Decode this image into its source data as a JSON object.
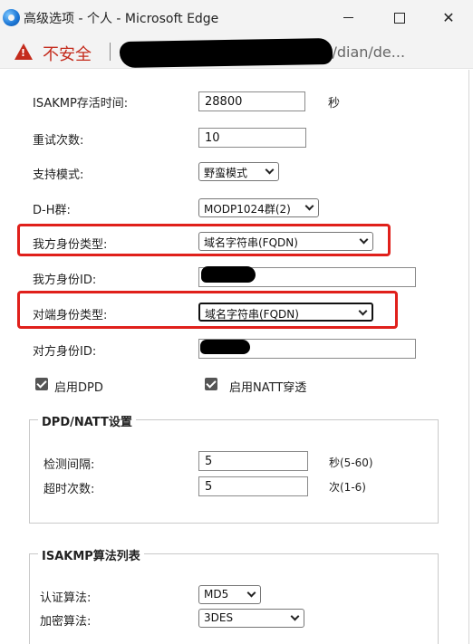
{
  "window": {
    "title": "高级选项 - 个人 - Microsoft Edge",
    "minimize_icon": "minimize-icon",
    "maximize_icon": "maximize-icon",
    "close_icon": "close-icon",
    "close_glyph": "✕"
  },
  "address": {
    "security_label": "不安全",
    "url_visible": "html/dian/de..."
  },
  "form": {
    "isakmp_lifetime": {
      "label": "ISAKMP存活时间:",
      "value": "28800",
      "unit": "秒"
    },
    "retry_count": {
      "label": "重试次数:",
      "value": "10"
    },
    "mode": {
      "label": "支持模式:",
      "value": "野蛮模式"
    },
    "dh_group": {
      "label": "D-H群:",
      "value": "MODP1024群(2)"
    },
    "local_id_type": {
      "label": "我方身份类型:",
      "value": "域名字符串(FQDN)"
    },
    "local_id": {
      "label": "我方身份ID:",
      "value": ""
    },
    "peer_id_type": {
      "label": "对端身份类型:",
      "value": "域名字符串(FQDN)"
    },
    "peer_id": {
      "label": "对方身份ID:",
      "value": ""
    },
    "enable_dpd": {
      "label": "启用DPD",
      "checked": true
    },
    "enable_natt": {
      "label": "启用NATT穿透",
      "checked": true
    }
  },
  "dpd_natt": {
    "legend": "DPD/NATT设置",
    "interval": {
      "label": "检测间隔:",
      "value": "5",
      "hint": "秒(5-60)"
    },
    "timeout": {
      "label": "超时次数:",
      "value": "5",
      "hint": "次(1-6)"
    }
  },
  "isakmp_algos": {
    "legend": "ISAKMP算法列表",
    "auth": {
      "label": "认证算法:",
      "value": "MD5"
    },
    "encrypt": {
      "label": "加密算法:",
      "value": "3DES"
    }
  },
  "colors": {
    "highlight_border": "#e0201b",
    "insecure_text": "#c42b1c"
  }
}
